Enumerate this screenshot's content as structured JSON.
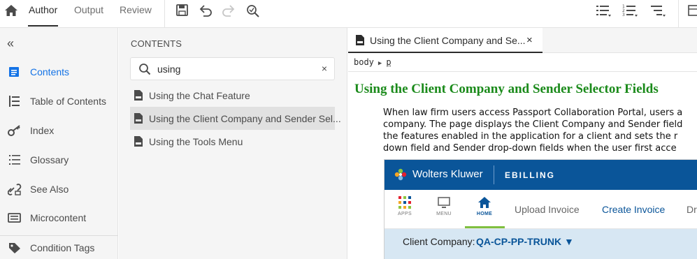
{
  "topbar": {
    "tabs": [
      "Author",
      "Output",
      "Review"
    ],
    "active_tab": "Author"
  },
  "rail": {
    "collapse_glyph": "«",
    "items": [
      {
        "label": "Contents",
        "icon": "contents-icon"
      },
      {
        "label": "Table of Contents",
        "icon": "toc-icon"
      },
      {
        "label": "Index",
        "icon": "key-icon"
      },
      {
        "label": "Glossary",
        "icon": "glossary-icon"
      },
      {
        "label": "See Also",
        "icon": "link-icon"
      },
      {
        "label": "Microcontent",
        "icon": "microcontent-icon"
      },
      {
        "label": "Condition Tags",
        "icon": "tag-icon"
      }
    ],
    "active": "Contents"
  },
  "contents": {
    "title": "CONTENTS",
    "search": {
      "value": "using",
      "clear_glyph": "×"
    },
    "files": [
      {
        "label": "Using the Chat Feature"
      },
      {
        "label": "Using the Client Company and Sender Sel..."
      },
      {
        "label": "Using the Tools Menu"
      }
    ],
    "selected_index": 1
  },
  "editor": {
    "tab_label": "Using the Client Company and Se...",
    "close_glyph": "×",
    "breadcrumb": {
      "body": "body",
      "p": "p"
    },
    "heading": "Using the Client Company and Sender Selector Fields",
    "paragraph_lines": [
      "When law firm users access Passport Collaboration Portal, users a",
      "company. The page displays the Client Company and Sender field",
      "the features enabled in the application for a client and sets the r",
      "down field and Sender drop-down fields when the user first acce"
    ]
  },
  "embedded": {
    "brand": "Wolters Kluwer",
    "product": "EBILLING",
    "apps": [
      {
        "label": "APPS"
      },
      {
        "label": "MENU"
      },
      {
        "label": "HOME"
      }
    ],
    "links": [
      "Upload Invoice",
      "Create Invoice",
      "Dr"
    ],
    "client_label": "Client Company:",
    "client_value": "QA-CP-PP-TRUNK ▼"
  },
  "colors": {
    "accent_blue": "#1473e6",
    "heading_green": "#1a8a1a",
    "wk_blue": "#0a5599",
    "home_underline": "#7fbf3f"
  }
}
